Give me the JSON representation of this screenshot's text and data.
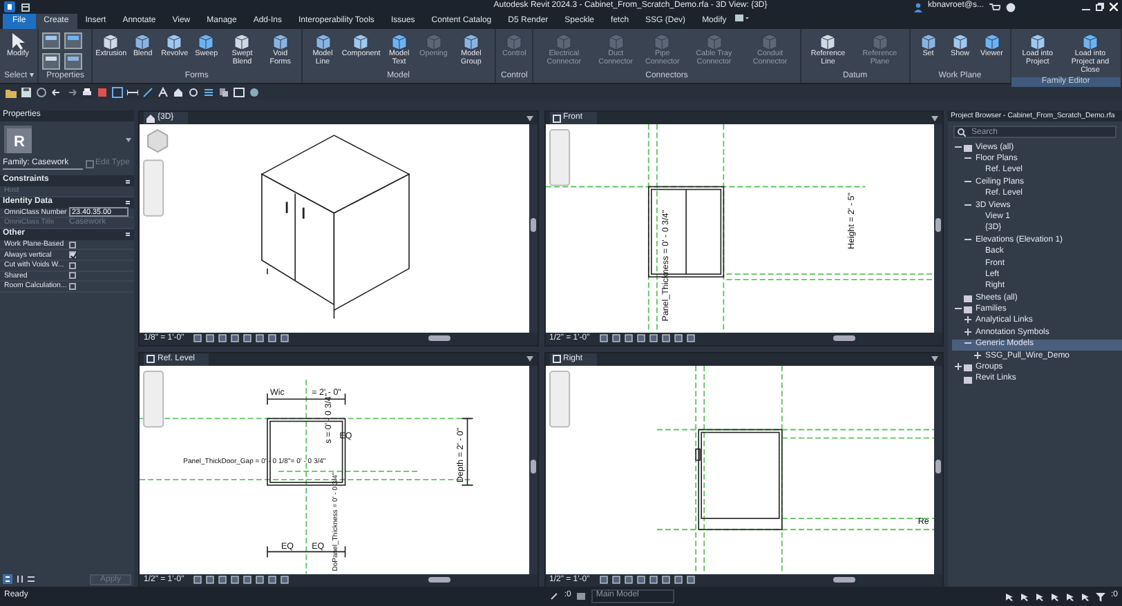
{
  "window": {
    "title": "Autodesk Revit 2024.3 - Cabinet_From_Scratch_Demo.rfa - 3D View: {3D}",
    "user": "kbnavroet@s..."
  },
  "file_button": "File",
  "tabs": [
    {
      "label": "Create",
      "selected": true
    },
    {
      "label": "Insert",
      "selected": false
    },
    {
      "label": "Annotate",
      "selected": false
    },
    {
      "label": "View",
      "selected": false
    },
    {
      "label": "Manage",
      "selected": false
    },
    {
      "label": "Add-Ins",
      "selected": false
    },
    {
      "label": "Interoperability Tools",
      "selected": false
    },
    {
      "label": "Issues",
      "selected": false
    },
    {
      "label": "Content Catalog",
      "selected": false
    },
    {
      "label": "D5 Render",
      "selected": false
    },
    {
      "label": "Speckle",
      "selected": false
    },
    {
      "label": "fetch",
      "selected": false
    },
    {
      "label": "SSG (Dev)",
      "selected": false
    },
    {
      "label": "Modify",
      "selected": false
    }
  ],
  "ribbon": [
    {
      "kind": "tools",
      "title": "Select ▾",
      "selected": false,
      "tools": [
        {
          "label": "Modify",
          "disabled": false
        }
      ]
    },
    {
      "kind": "icon_grid",
      "title": "Properties",
      "selected": false
    },
    {
      "kind": "tools",
      "title": "Forms",
      "selected": false,
      "tools": [
        {
          "label": "Extrusion",
          "disabled": false
        },
        {
          "label": "Blend",
          "disabled": false
        },
        {
          "label": "Revolve",
          "disabled": false
        },
        {
          "label": "Sweep",
          "disabled": false
        },
        {
          "label": "Swept Blend",
          "disabled": false
        },
        {
          "label": "Void Forms",
          "disabled": false
        }
      ]
    },
    {
      "kind": "tools",
      "title": "Model",
      "selected": false,
      "tools": [
        {
          "label": "Model Line",
          "disabled": false
        },
        {
          "label": "Component",
          "disabled": false
        },
        {
          "label": "Model Text",
          "disabled": false
        },
        {
          "label": "Opening",
          "disabled": true
        },
        {
          "label": "Model Group",
          "disabled": false
        }
      ]
    },
    {
      "kind": "tools",
      "title": "Control",
      "selected": false,
      "tools": [
        {
          "label": "Control",
          "disabled": true
        }
      ]
    },
    {
      "kind": "tools",
      "title": "Connectors",
      "selected": false,
      "tools": [
        {
          "label": "Electrical Connector",
          "disabled": true
        },
        {
          "label": "Duct Connector",
          "disabled": true
        },
        {
          "label": "Pipe Connector",
          "disabled": true
        },
        {
          "label": "Cable Tray Connector",
          "disabled": true
        },
        {
          "label": "Conduit Connector",
          "disabled": true
        }
      ]
    },
    {
      "kind": "tools",
      "title": "Datum",
      "selected": false,
      "tools": [
        {
          "label": "Reference Line",
          "disabled": false
        },
        {
          "label": "Reference Plane",
          "disabled": true
        }
      ]
    },
    {
      "kind": "tools",
      "title": "Work Plane",
      "selected": false,
      "tools": [
        {
          "label": "Set",
          "disabled": false
        },
        {
          "label": "Show",
          "disabled": false
        },
        {
          "label": "Viewer",
          "disabled": false
        }
      ]
    },
    {
      "kind": "tools",
      "title": "Family Editor",
      "selected": true,
      "tools": [
        {
          "label": "Load into Project",
          "disabled": false
        },
        {
          "label": "Load into Project and Close",
          "disabled": false
        }
      ]
    }
  ],
  "properties": {
    "title": "Properties",
    "type_icon": "R",
    "family": "Family: Casework",
    "edit_type": "Edit Type",
    "sections": [
      {
        "title": "Constraints",
        "rows": [
          {
            "kind": "text",
            "label": "Host",
            "disabled": true
          }
        ]
      },
      {
        "title": "Identity Data",
        "rows": [
          {
            "kind": "field",
            "label": "OmniClass Number",
            "value": "23.40.35.00",
            "disabled": false
          },
          {
            "kind": "text",
            "label": "OmniClass Title",
            "value": "Casework",
            "disabled": true
          }
        ]
      },
      {
        "title": "Other",
        "rows": [
          {
            "kind": "check",
            "label": "Work Plane-Based",
            "checked": false
          },
          {
            "kind": "check",
            "label": "Always vertical",
            "checked": true
          },
          {
            "kind": "check",
            "label": "Cut with Voids W...",
            "checked": false
          },
          {
            "kind": "check",
            "label": "Shared",
            "checked": false
          },
          {
            "kind": "check",
            "label": "Room Calculation...",
            "checked": false
          }
        ]
      }
    ],
    "apply": "Apply"
  },
  "views": [
    {
      "title": "{3D}",
      "kind": "isometric",
      "scale": "1/8\" = 1'-0\""
    },
    {
      "title": "Front",
      "kind": "front",
      "scale": "1/2\" = 1'-0\"",
      "labels": [
        "Panel_Thickness = 0' - 0 3/4\"",
        "Height = 2' - 5\""
      ]
    },
    {
      "title": "Ref. Level",
      "kind": "plan",
      "scale": "1/2\" = 1'-0\"",
      "labels": [
        "Wic",
        "= 2' - 0\"",
        "s = 0' - 0 3/4\"",
        "EQ",
        "Panel_ThickDoor_Gap = 0' - 0 1/8\"= 0' - 0 3/4\"",
        "Depth = 2' - 0\"",
        "DoPanel_Thickness = 0' - 0 3/4\"",
        "EQ",
        "EQ"
      ]
    },
    {
      "title": "Right",
      "kind": "right",
      "scale": "1/2\" = 1'-0\"",
      "labels": [
        "Re"
      ]
    }
  ],
  "project_browser": {
    "title": "Project Browser - Cabinet_From_Scratch_Demo.rfa",
    "search_placeholder": "Search",
    "tree": [
      {
        "label": "Views (all)",
        "expanded": true,
        "children": [
          {
            "label": "Floor Plans",
            "expanded": true,
            "children": [
              {
                "label": "Ref. Level"
              }
            ]
          },
          {
            "label": "Ceiling Plans",
            "expanded": true,
            "children": [
              {
                "label": "Ref. Level"
              }
            ]
          },
          {
            "label": "3D Views",
            "expanded": true,
            "children": [
              {
                "label": "View 1"
              },
              {
                "label": "{3D}"
              }
            ]
          },
          {
            "label": "Elevations (Elevation 1)",
            "expanded": true,
            "children": [
              {
                "label": "Back"
              },
              {
                "label": "Front"
              },
              {
                "label": "Left"
              },
              {
                "label": "Right"
              }
            ]
          }
        ]
      },
      {
        "label": "Sheets (all)"
      },
      {
        "label": "Families",
        "expanded": true,
        "children": [
          {
            "label": "Analytical Links",
            "expanded": false
          },
          {
            "label": "Annotation Symbols",
            "expanded": false
          },
          {
            "label": "Generic Models",
            "expanded": true,
            "selected": true,
            "children": [
              {
                "label": "SSG_Pull_Wire_Demo",
                "expanded": false
              }
            ]
          }
        ]
      },
      {
        "label": "Groups",
        "expanded": false
      },
      {
        "label": "Revit Links"
      }
    ]
  },
  "status_bar": {
    "text": "Ready",
    "count_1": ":0",
    "model": "Main Model",
    "filter_count": ":0"
  }
}
